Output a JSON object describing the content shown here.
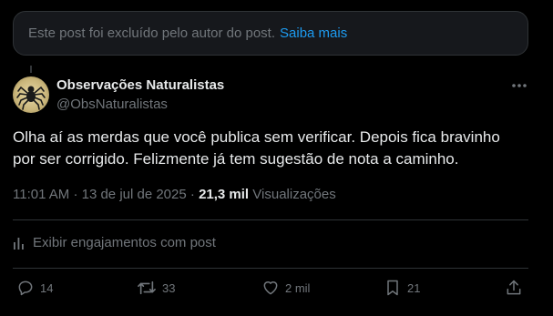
{
  "deleted_notice": {
    "text": "Este post foi excluído pelo autor do post.",
    "link": "Saiba mais"
  },
  "author": {
    "name": "Observações Naturalistas",
    "handle": "@ObsNaturalistas"
  },
  "post": {
    "text_line1": "Olha aí as merdas que você publica sem verificar. Depois fica bravinho",
    "text_line2": "por ser corrigido. Felizmente já tem sugestão de nota a caminho.",
    "time": "11:01 AM",
    "sep1": "·",
    "date": "13 de jul de 2025",
    "sep2": "·",
    "views_count": "21,3 mil",
    "views_label": "Visualizações"
  },
  "engagements_label": "Exibir engajamentos com post",
  "actions": {
    "replies": "14",
    "reposts": "33",
    "likes": "2 mil",
    "bookmarks": "21"
  },
  "colors": {
    "background": "#000000",
    "text_primary": "#e7e9ea",
    "text_secondary": "#71767b",
    "link": "#1d9bf0",
    "border": "#2f3336"
  },
  "icons": [
    "more-icon",
    "analytics-icon",
    "reply-icon",
    "repost-icon",
    "like-icon",
    "bookmark-icon",
    "share-icon"
  ]
}
